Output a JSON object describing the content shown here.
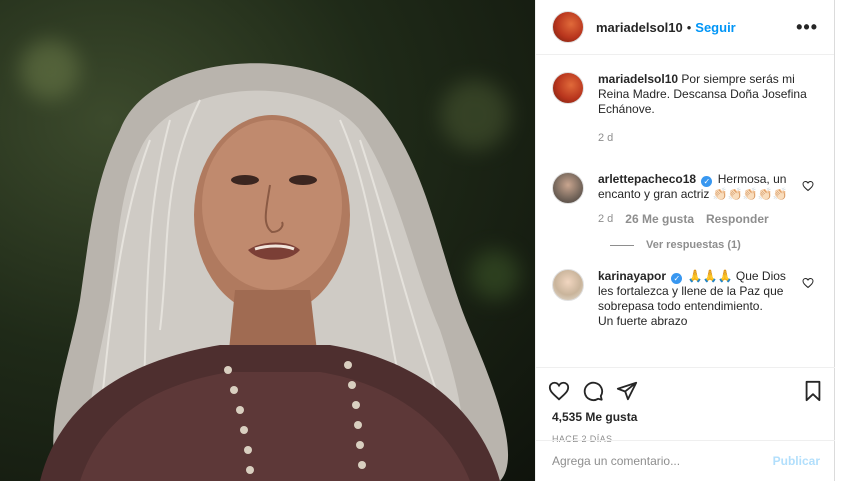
{
  "post": {
    "author": "mariadelsol10",
    "follow_label": "Seguir",
    "separator": "•",
    "more_label": "•••"
  },
  "caption": {
    "author": "mariadelsol10",
    "text": "Por siempre serás mi Reina Madre. Descansa Doña Josefina Echánove.",
    "time": "2 d"
  },
  "comments": [
    {
      "author": "arlettepacheco18",
      "text": "Hermosa, un encanto y gran actriz 👏🏻👏🏻👏🏻👏🏻👏🏻",
      "time": "2 d",
      "likes": "26 Me gusta",
      "reply_label": "Responder",
      "view_replies": "Ver respuestas (1)"
    },
    {
      "author": "karinayapor",
      "text": "🙏🙏🙏 Que Dios les fortalezca y llene de la Paz que sobrepasa todo entendimiento.",
      "text2": "Un fuerte abrazo"
    }
  ],
  "footer": {
    "likes": "4,535 Me gusta",
    "time": "HACE 2 DÍAS",
    "comment_placeholder": "Agrega un comentario...",
    "publish_label": "Publicar"
  },
  "icons": {
    "like": "heart-icon",
    "comment": "comment-icon",
    "share": "paper-plane-icon",
    "save": "bookmark-icon"
  },
  "colors": {
    "link_blue": "#0095f6",
    "publish_disabled": "#b2dffc",
    "muted": "#8e8e8e",
    "text": "#262626",
    "verified": "#3897f0"
  }
}
